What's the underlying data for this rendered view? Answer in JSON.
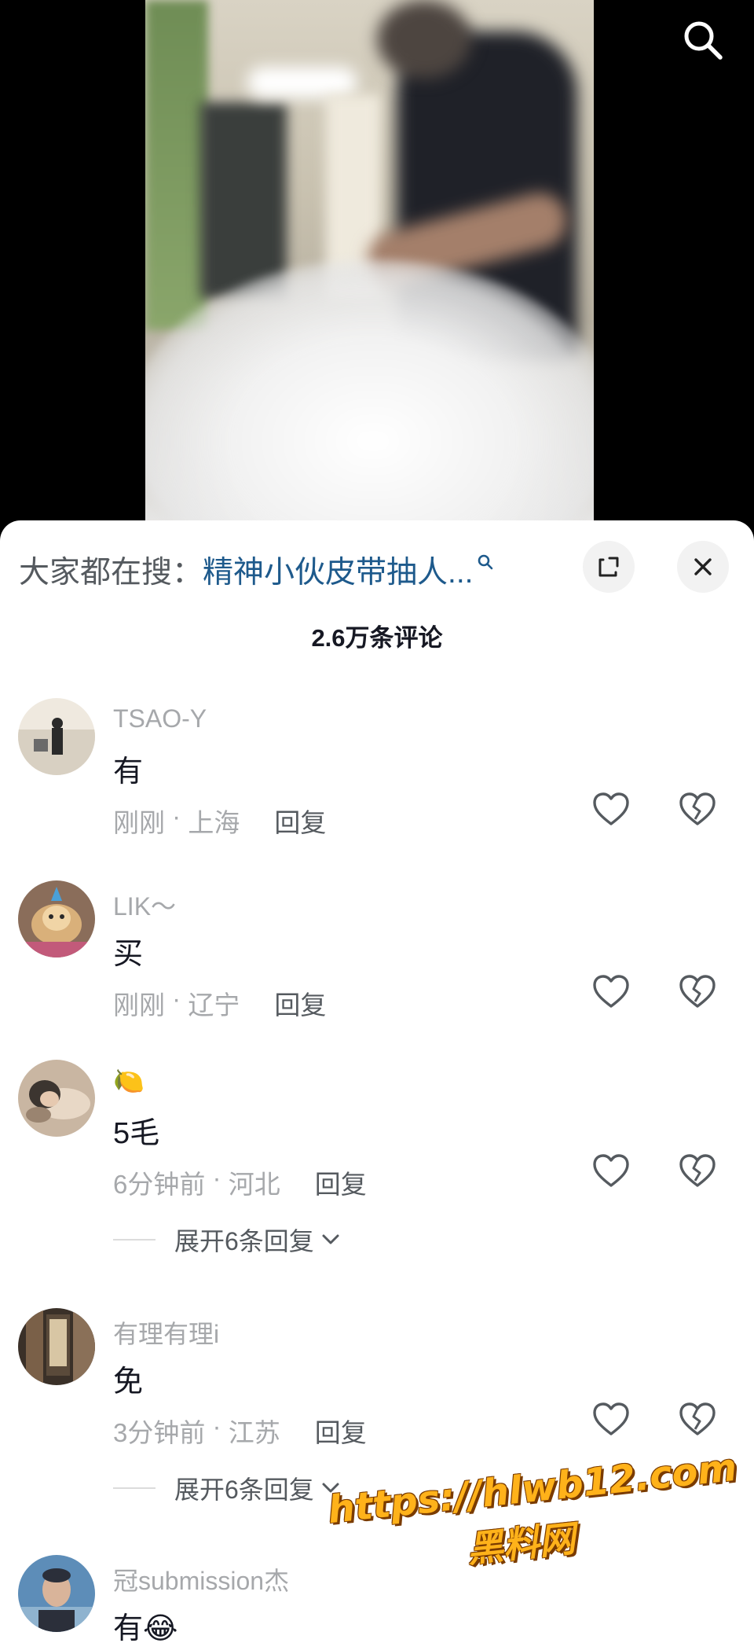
{
  "video": {
    "search_icon": "search-icon"
  },
  "sheet": {
    "hot_search_label": "大家都在搜：",
    "hot_search_keyword": "精神小伙皮带抽人...",
    "comment_count": "2.6万条评论"
  },
  "comments": [
    {
      "username": "TSAO-Y",
      "text": "有",
      "time": "刚刚",
      "location": "上海",
      "reply_label": "回复",
      "avatar_colors": [
        "#efe9df",
        "#2a2a2a"
      ]
    },
    {
      "username": "LIK～",
      "text": "买",
      "time": "刚刚",
      "location": "辽宁",
      "reply_label": "回复",
      "avatar_colors": [
        "#d9b07a",
        "#c25a7a"
      ]
    },
    {
      "username": "🍋",
      "text": "5毛",
      "time": "6分钟前",
      "location": "河北",
      "reply_label": "回复",
      "expand_label": "展开6条回复",
      "avatar_colors": [
        "#b89f8a",
        "#3c3530"
      ]
    },
    {
      "username": "有理有理i",
      "text": "免",
      "time": "3分钟前",
      "location": "江苏",
      "reply_label": "回复",
      "expand_label": "展开6条回复",
      "avatar_colors": [
        "#5a4a3a",
        "#d8c6a4"
      ]
    },
    {
      "username": "冠submission杰",
      "text": "有😂",
      "avatar_colors": [
        "#5d8db8",
        "#2b2f3a"
      ]
    }
  ],
  "watermark": {
    "url": "https://hlwb12.com",
    "name": "黑料网"
  },
  "colors": {
    "keyword": "#1e5a8c",
    "secondary_text": "#a6a8ab",
    "primary_text": "#161823"
  }
}
